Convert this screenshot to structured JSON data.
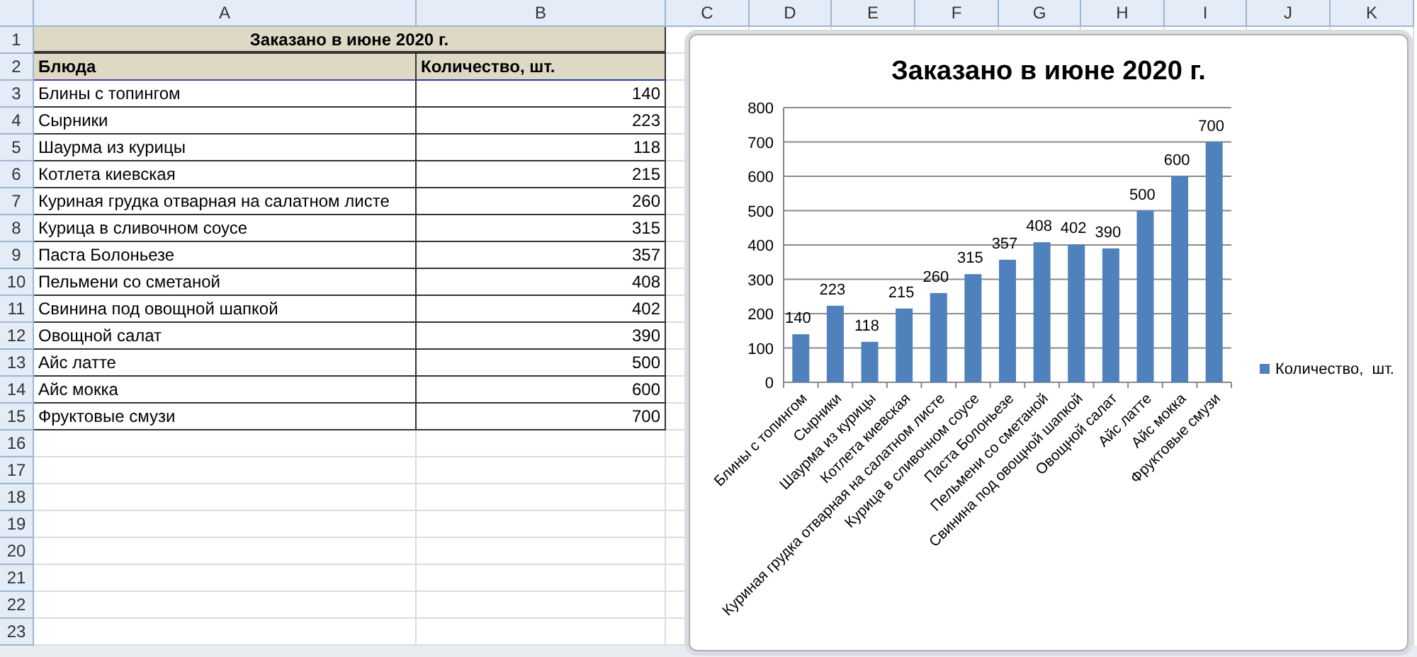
{
  "sheet": {
    "columns": [
      "A",
      "B",
      "C",
      "D",
      "E",
      "F",
      "G",
      "H",
      "I",
      "J",
      "K"
    ],
    "row_numbers": [
      "1",
      "2",
      "3",
      "4",
      "5",
      "6",
      "7",
      "8",
      "9",
      "10",
      "11",
      "12",
      "13",
      "14",
      "15",
      "16",
      "17",
      "18",
      "19",
      "20",
      "21",
      "22",
      "23"
    ]
  },
  "table": {
    "title": "Заказано в июне 2020 г.",
    "headers": [
      "Блюда",
      "Количество, шт."
    ],
    "rows": [
      {
        "dish": "Блины с топингом",
        "qty": "140"
      },
      {
        "dish": "Сырники",
        "qty": "223"
      },
      {
        "dish": "Шаурма из курицы",
        "qty": "118"
      },
      {
        "dish": "Котлета киевская",
        "qty": "215"
      },
      {
        "dish": "Куриная грудка отварная на салатном листе",
        "qty": "260"
      },
      {
        "dish": "Курица в сливочном соусе",
        "qty": "315"
      },
      {
        "dish": "Паста Болоньезе",
        "qty": "357"
      },
      {
        "dish": "Пельмени со сметаной",
        "qty": "408"
      },
      {
        "dish": "Свинина под овощной шапкой",
        "qty": "402"
      },
      {
        "dish": "Овощной салат",
        "qty": "390"
      },
      {
        "dish": "Айс латте",
        "qty": "500"
      },
      {
        "dish": "Айс мокка",
        "qty": "600"
      },
      {
        "dish": "Фруктовые смузи",
        "qty": "700"
      }
    ]
  },
  "chart": {
    "chart_data": {
      "type": "bar",
      "title": "Заказано в июне 2020 г.",
      "categories": [
        "Блины с топингом",
        "Сырники",
        "Шаурма из курицы",
        "Котлета киевская",
        "Куриная грудка отварная на салатном листе",
        "Курица в сливочном соусе",
        "Паста Болоньезе",
        "Пельмени  со сметаной",
        "Свинина под овощной шапкой",
        "Овощной салат",
        "Айс латте",
        "Айс мокка",
        "Фруктовые смузи"
      ],
      "series": [
        {
          "name": "Количество,  шт.",
          "color": "#4f81bd",
          "values": [
            140,
            223,
            118,
            215,
            260,
            315,
            357,
            408,
            402,
            390,
            500,
            600,
            700
          ]
        }
      ],
      "grid": true,
      "ylim": [
        0,
        800
      ],
      "yticks": [
        0,
        100,
        200,
        300,
        400,
        500,
        600,
        700,
        800
      ],
      "data_labels": true
    }
  }
}
